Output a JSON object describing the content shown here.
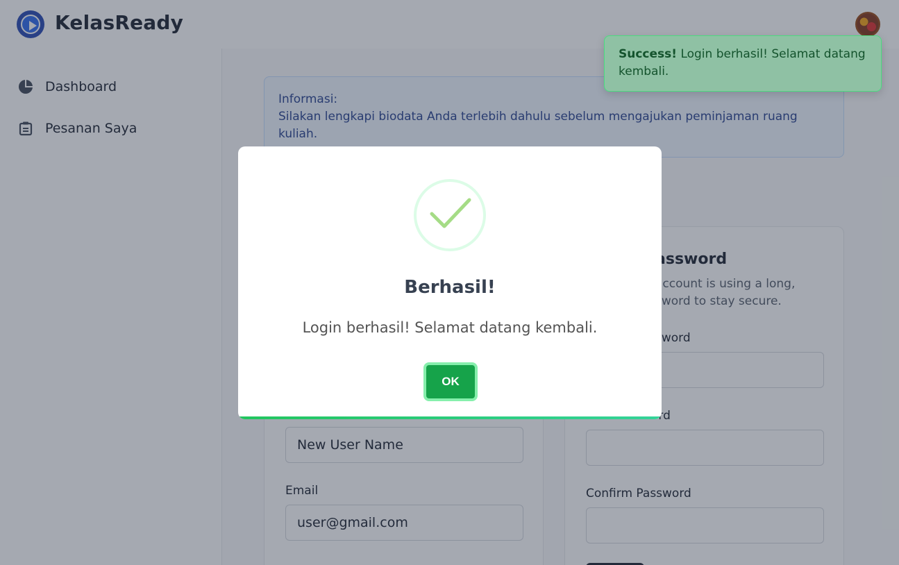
{
  "app": {
    "title": "KelasReady"
  },
  "sidebar": {
    "items": [
      {
        "label": "Dashboard",
        "icon": "pie-chart-icon"
      },
      {
        "label": "Pesanan Saya",
        "icon": "clipboard-list-icon"
      }
    ]
  },
  "info": {
    "title": "Informasi:",
    "message": "Silakan lengkapi biodata Anda terlebih dahulu sebelum mengajukan peminjaman ruang kuliah."
  },
  "profile_form": {
    "name_value": "New User Name",
    "email_label": "Email",
    "email_value": "user@gmail.com"
  },
  "password_form": {
    "title_visible": "assword",
    "desc_line1": "account is using a long,",
    "desc_line2": "sword to stay secure.",
    "current_label_visible": "sword",
    "new_label": "New Password",
    "confirm_label": "Confirm Password"
  },
  "toast": {
    "strong": "Success!",
    "message": "Login berhasil! Selamat datang kembali."
  },
  "modal": {
    "title": "Berhasil!",
    "message": "Login berhasil! Selamat datang kembali.",
    "ok_label": "OK"
  },
  "colors": {
    "accent_green": "#16a34a",
    "brand_blue": "#1e40af",
    "info_blue": "#1e3a8a"
  }
}
